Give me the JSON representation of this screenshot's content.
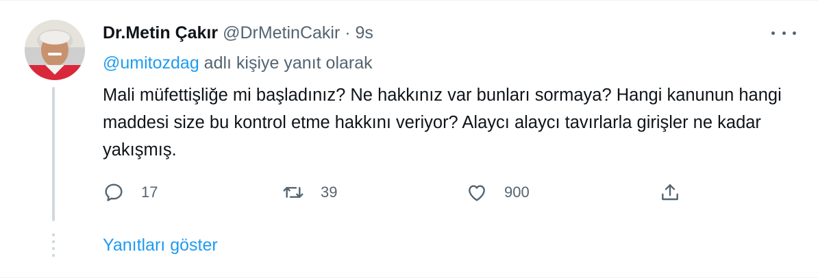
{
  "tweet": {
    "author_name": "Dr.Metin Çakır",
    "author_handle": "@DrMetinCakir",
    "separator": "·",
    "time": "9s",
    "reply_to_handle": "@umitozdag",
    "reply_to_suffix": " adlı kişiye yanıt olarak",
    "text": "Mali müfettişliğe mi başladınız? Ne hakkınız var bunları sormaya? Hangi kanunun hangi maddesi size bu kontrol etme hakkını veriyor? Alaycı alaycı tavırlarla girişler ne kadar yakışmış.",
    "reply_count": "17",
    "retweet_count": "39",
    "like_count": "900"
  },
  "footer": {
    "show_replies_label": "Yanıtları göster"
  },
  "icons": {
    "reply": "reply-icon",
    "retweet": "retweet-icon",
    "like": "heart-icon",
    "share": "share-icon",
    "more": "more-icon"
  },
  "colors": {
    "text": "#0f1419",
    "secondary": "#536471",
    "accent": "#1d9bf0",
    "thread_line": "#cfd9de"
  }
}
